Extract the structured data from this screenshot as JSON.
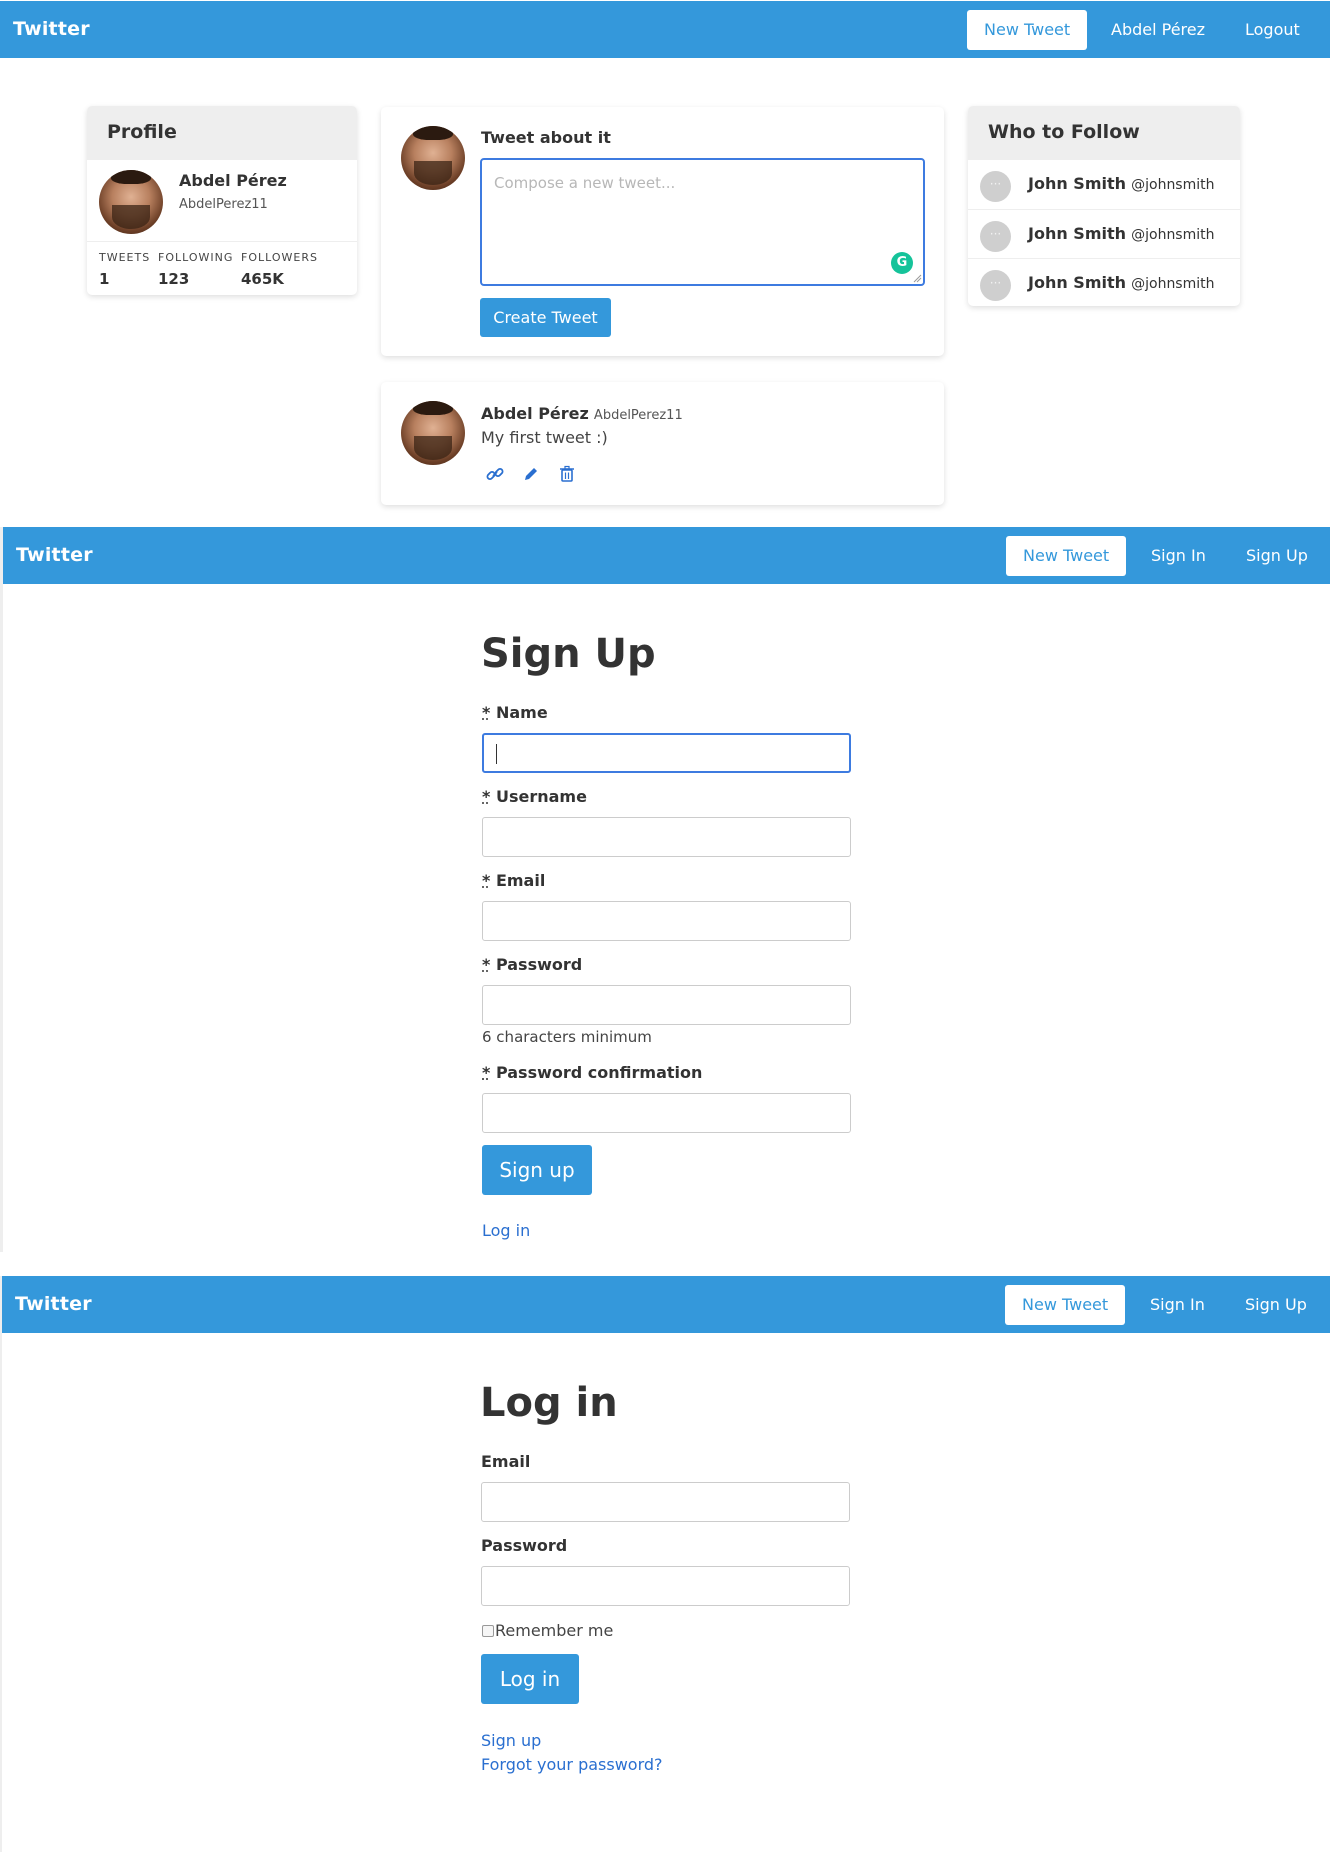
{
  "screen1": {
    "navbar": {
      "brand": "Twitter",
      "new_tweet": "New Tweet",
      "user_link": "Abdel Pérez",
      "logout": "Logout"
    },
    "profile": {
      "title": "Profile",
      "name": "Abdel Pérez",
      "username": "AbdelPerez11",
      "stats": [
        {
          "label": "TWEETS",
          "value": "1"
        },
        {
          "label": "FOLLOWING",
          "value": "123"
        },
        {
          "label": "FOLLOWERS",
          "value": "465K"
        }
      ]
    },
    "compose": {
      "title": "Tweet about it",
      "placeholder": "Compose a new tweet...",
      "submit": "Create Tweet",
      "grammarly": "G"
    },
    "tweet": {
      "name": "Abdel Pérez",
      "username": "AbdelPerez11",
      "text": "My first tweet :)",
      "actions": [
        "link-icon",
        "pencil-icon",
        "trash-icon"
      ]
    },
    "who_to_follow": {
      "title": "Who to Follow",
      "users": [
        {
          "name": "John Smith",
          "handle": "@johnsmith"
        },
        {
          "name": "John Smith",
          "handle": "@johnsmith"
        },
        {
          "name": "John Smith",
          "handle": "@johnsmith"
        }
      ]
    }
  },
  "screen2": {
    "navbar": {
      "brand": "Twitter",
      "new_tweet": "New Tweet",
      "sign_in": "Sign In",
      "sign_up": "Sign Up"
    },
    "title": "Sign Up",
    "required_marker": "*",
    "fields": [
      {
        "label": "Name"
      },
      {
        "label": "Username"
      },
      {
        "label": "Email"
      },
      {
        "label": "Password",
        "hint": "6 characters minimum"
      },
      {
        "label": "Password confirmation"
      }
    ],
    "submit": "Sign up",
    "login_link": "Log in"
  },
  "screen3": {
    "navbar": {
      "brand": "Twitter",
      "new_tweet": "New Tweet",
      "sign_in": "Sign In",
      "sign_up": "Sign Up"
    },
    "title": "Log in",
    "fields": [
      {
        "label": "Email"
      },
      {
        "label": "Password"
      }
    ],
    "remember_me": "Remember me",
    "submit": "Log in",
    "signup_link": "Sign up",
    "forgot_link": "Forgot your password?"
  },
  "colors": {
    "primary": "#3498db",
    "focus_border": "#3d7be0",
    "link": "#2a6fd0",
    "card_header": "#eeeeee",
    "grammarly": "#15c39a"
  }
}
